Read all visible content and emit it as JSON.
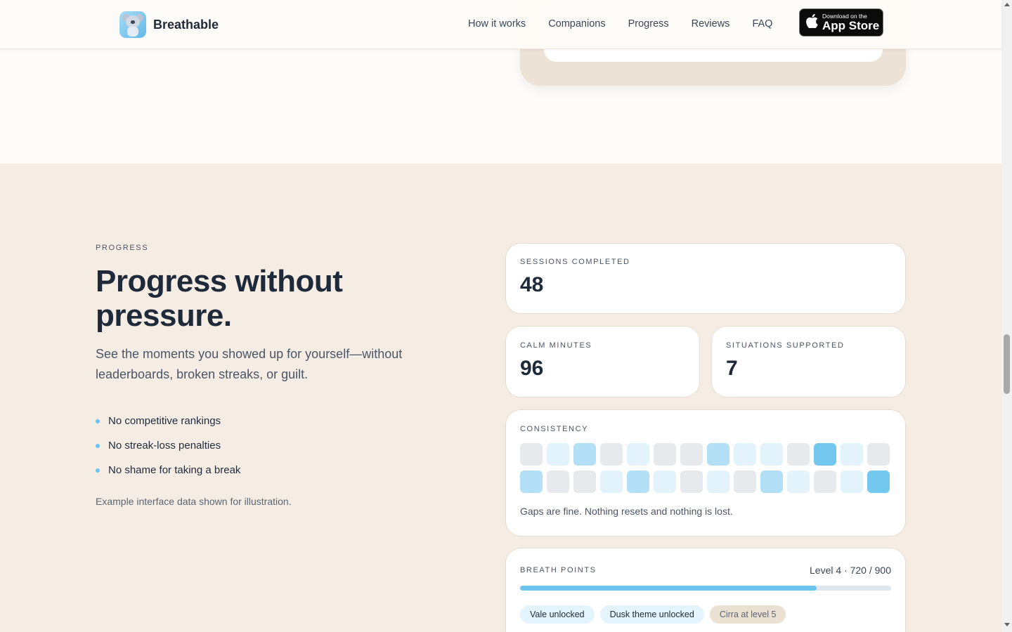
{
  "brand": {
    "name": "Breathable"
  },
  "nav": [
    "How it works",
    "Companions",
    "Progress",
    "Reviews",
    "FAQ"
  ],
  "appstore": {
    "small": "Download on the",
    "big": "App Store"
  },
  "progress": {
    "eyebrow": "PROGRESS",
    "title": "Progress without pressure.",
    "subtitle": "See the moments you showed up for yourself—without leaderboards, broken streaks, or guilt.",
    "bullets": [
      "No competitive rankings",
      "No streak-loss penalties",
      "No shame for taking a break"
    ],
    "note": "Example interface data shown for illustration."
  },
  "stats": {
    "sessions": {
      "label": "SESSIONS COMPLETED",
      "value": "48"
    },
    "calm": {
      "label": "CALM MINUTES",
      "value": "96"
    },
    "situations": {
      "label": "SITUATIONS SUPPORTED",
      "value": "7"
    }
  },
  "consistency": {
    "label": "CONSISTENCY",
    "cells": [
      0,
      1,
      2,
      0,
      1,
      0,
      0,
      2,
      1,
      1,
      0,
      3,
      1,
      0,
      2,
      0,
      0,
      1,
      2,
      1,
      0,
      1,
      0,
      2,
      1,
      0,
      1,
      3
    ],
    "colors": [
      "#e6eaec",
      "#e3f3fb",
      "#b3e0f6",
      "#74c7ef"
    ],
    "note": "Gaps are fine. Nothing resets and nothing is lost."
  },
  "breath_points": {
    "label": "BREATH POINTS",
    "level": "Level 4 · 720 / 900",
    "progress": 0.8,
    "chips": [
      {
        "text": "Vale unlocked",
        "muted": false
      },
      {
        "text": "Dusk theme unlocked",
        "muted": false
      },
      {
        "text": "Cirra at level 5",
        "muted": true
      }
    ]
  },
  "colors": {
    "accent": "#6bc3ef",
    "section_bg": "#f5ede4",
    "page_bg": "#fefcf8",
    "text": "#1e2a3a"
  }
}
